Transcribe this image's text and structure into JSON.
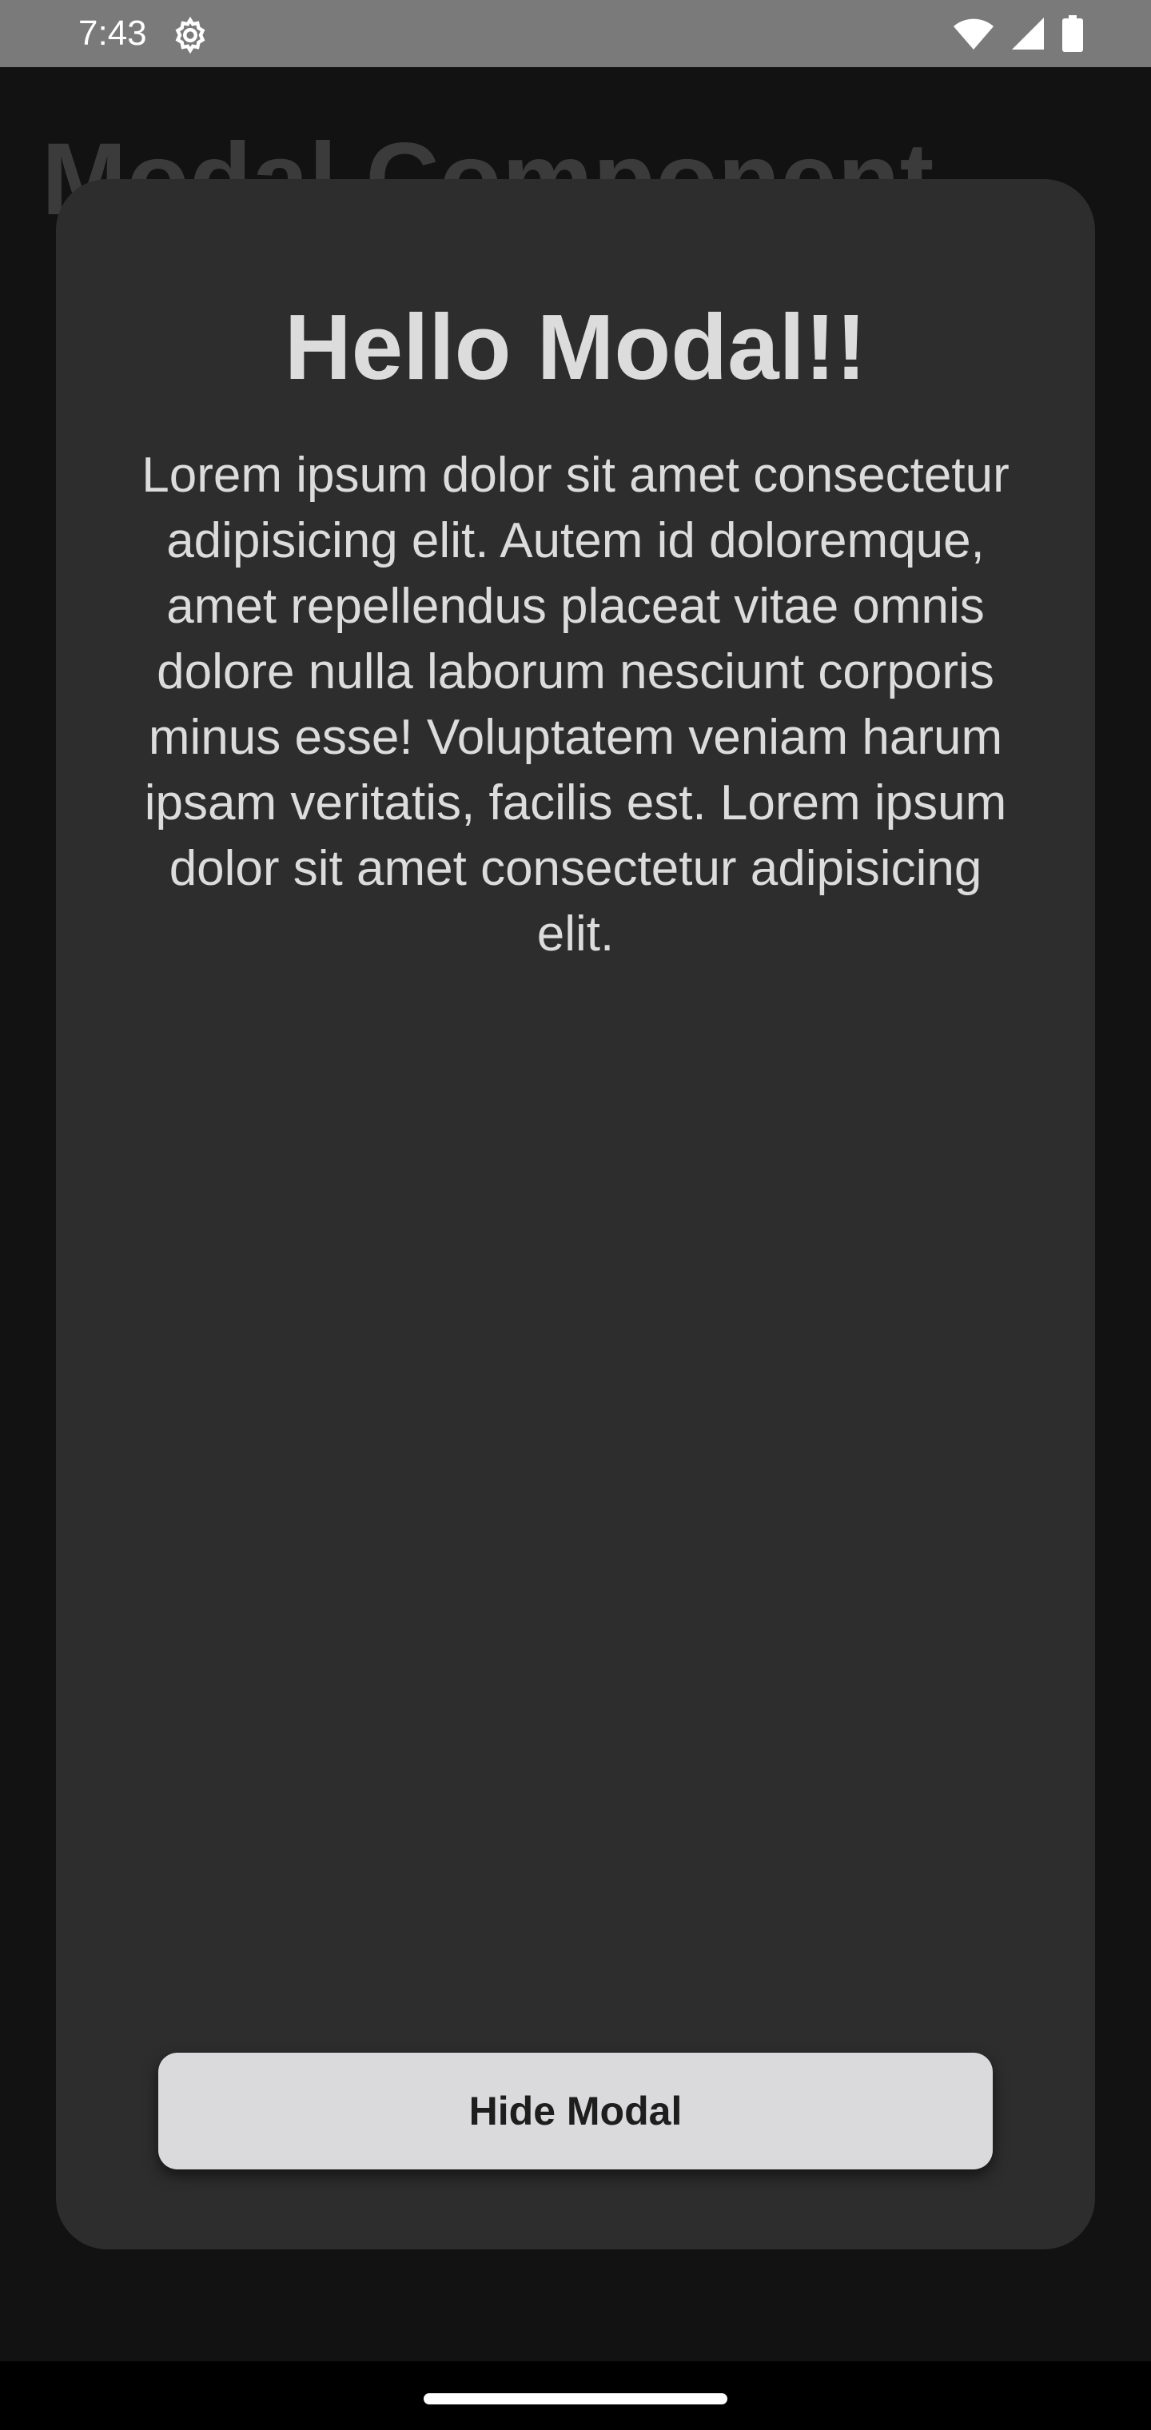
{
  "status_bar": {
    "time": "7:43",
    "icons": [
      "settings-gear-icon",
      "wifi-icon",
      "cellular-signal-icon",
      "battery-icon"
    ]
  },
  "background": {
    "title": "Modal Component"
  },
  "modal": {
    "title": "Hello Modal!!",
    "body": "Lorem ipsum dolor sit amet consectetur adipisicing elit. Autem id doloremque, amet repellendus placeat vitae omnis dolore nulla laborum nesciunt corporis minus esse! Voluptatem veniam harum ipsam veritatis, facilis est. Lorem ipsum dolor sit amet consectetur adipisicing elit.",
    "button_label": "Hide Modal"
  },
  "colors": {
    "page_background": "#121212",
    "status_bar": "#7a7a7a",
    "modal_background": "#2d2d2d",
    "modal_text": "#dcdcdc",
    "button_background": "#dadadc",
    "button_text": "#1e1e1e"
  }
}
